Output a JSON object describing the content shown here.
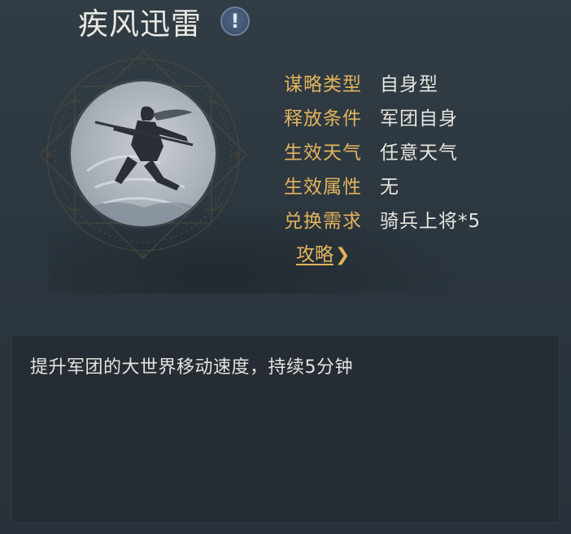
{
  "skill": {
    "title": "疾风迅雷",
    "info_icon": "exclamation-info-icon",
    "portrait": "swordsman-leaping-icon"
  },
  "attributes": [
    {
      "label": "谋略类型",
      "value": "自身型"
    },
    {
      "label": "释放条件",
      "value": "军团自身"
    },
    {
      "label": "生效天气",
      "value": "任意天气"
    },
    {
      "label": "生效属性",
      "value": "无"
    },
    {
      "label": "兑换需求",
      "value": "骑兵上将*5"
    }
  ],
  "strategy_link": {
    "label": "攻略",
    "icon": "chevron-right-icon"
  },
  "description": "提升军团的大世界移动速度，持续5分钟",
  "colors": {
    "background": "#2c363e",
    "label_gold": "#e2b45d",
    "text": "#e6e4df",
    "panel": "#242c33"
  }
}
